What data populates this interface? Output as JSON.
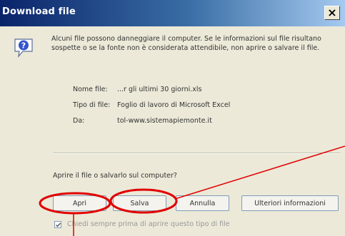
{
  "window": {
    "title": "Download file",
    "close_glyph": "×"
  },
  "warning": {
    "text": "Alcuni file possono danneggiare il computer. Se le informazioni sul file risultano sospette o se la fonte non è considerata attendibile, non aprire o salvare il file.",
    "icon": "question-icon"
  },
  "file_info": {
    "name_label": "Nome file:",
    "name_value": "...r gli ultimi 30 giorni.xls",
    "type_label": "Tipo di file:",
    "type_value": "Foglio di lavoro di Microsoft Excel",
    "from_label": "Da:",
    "from_value": "tol-www.sistemapiemonte.it"
  },
  "prompt": {
    "question": "Aprire il file o salvarlo sul computer?"
  },
  "buttons": {
    "open": "Apri",
    "save": "Salva",
    "cancel": "Annulla",
    "more_info": "Ulteriori informazioni"
  },
  "checkbox": {
    "label": "Chiedi sempre prima di aprire questo tipo di file",
    "checked": true
  },
  "colors": {
    "title_bar_start": "#0a246a",
    "annotation_red": "#e00000"
  }
}
